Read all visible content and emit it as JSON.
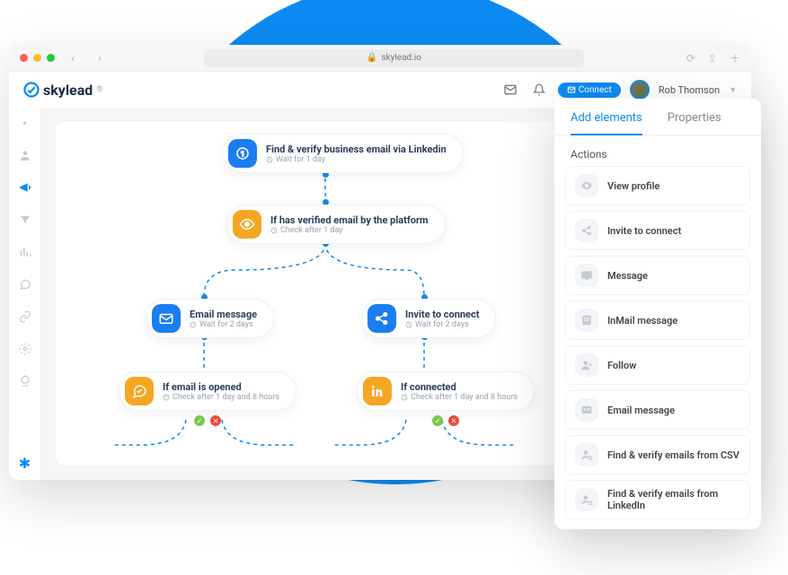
{
  "browser": {
    "url": "skylead.io"
  },
  "app": {
    "brand": "skylead",
    "connect": "Connect",
    "user": "Rob Thomson"
  },
  "nodes": {
    "n1": {
      "title": "Find & verify business email via Linkedin",
      "sub": "Wait for 1 day"
    },
    "n2": {
      "title": "If has verified email by the platform",
      "sub": "Check after 1 day"
    },
    "n3": {
      "title": "Email message",
      "sub": "Wait for 2 days"
    },
    "n4": {
      "title": "Invite to connect",
      "sub": "Wait for 2 days"
    },
    "n5": {
      "title": "If email is opened",
      "sub": "Check after 1 day and 8 hours"
    },
    "n6": {
      "title": "If connected",
      "sub": "Check after 1 day and 8 hours"
    }
  },
  "panel": {
    "tab_add": "Add elements",
    "tab_props": "Properties",
    "section": "Actions",
    "items": {
      "view": "View profile",
      "invite": "Invite to connect",
      "message": "Message",
      "inmail": "InMail message",
      "follow": "Follow",
      "email": "Email message",
      "csv": "Find & verify emails from CSV",
      "li": "Find & verify emails from LinkedIn"
    }
  }
}
